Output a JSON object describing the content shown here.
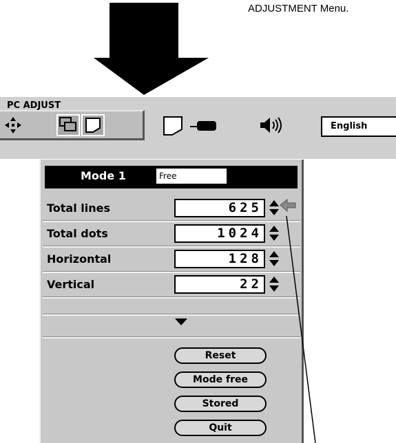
{
  "caption": "ADJUSTMENT Menu.",
  "menu_bar": {
    "title": "PC ADJUST",
    "icons": [
      "move-icon",
      "window-icon",
      "screen-icon",
      "screen-icon",
      "projector-icon",
      "speaker-icon"
    ],
    "language": "English"
  },
  "mode_header": {
    "label": "Mode 1",
    "value": "Free"
  },
  "rows": [
    {
      "label": "Total lines",
      "value": "625"
    },
    {
      "label": "Total dots",
      "value": "1024"
    },
    {
      "label": "Horizontal",
      "value": "128"
    },
    {
      "label": "Vertical",
      "value": "22"
    }
  ],
  "buttons": {
    "reset": "Reset",
    "mode_free": "Mode free",
    "stored": "Stored",
    "quit": "Quit"
  },
  "colors": {
    "panel": "#c8c8c8",
    "header": "#000000"
  }
}
